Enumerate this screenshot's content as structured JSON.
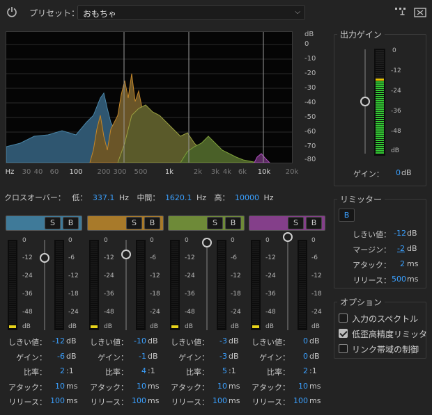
{
  "header": {
    "preset_label": "プリセット：",
    "preset_value": "おもちゃ"
  },
  "spectrum": {
    "db_scale": [
      "dB",
      "0",
      "-10",
      "-20",
      "-30",
      "-40",
      "-50",
      "-60",
      "-70",
      "-80"
    ],
    "hz_scale": [
      "Hz",
      "30",
      "40",
      "60",
      "100",
      "200",
      "300",
      "500",
      "1k",
      "2k",
      "3k",
      "4k",
      "6k",
      "10k",
      "20k"
    ]
  },
  "crossover": {
    "label": "クロスオーバー：",
    "low_label": "低：",
    "low_value": "337.1",
    "mid_label": "中間：",
    "mid_value": "1620.1",
    "high_label": "高：",
    "high_value": "10000",
    "unit": "Hz"
  },
  "bands": [
    {
      "color": "#3f7a99",
      "s": "S",
      "b": "B",
      "threshold": "-12",
      "gain": "-6",
      "ratio": "2",
      "attack": "10",
      "release": "100",
      "slider_db": -12
    },
    {
      "color": "#a87a2a",
      "s": "S",
      "b": "B",
      "threshold": "-10",
      "gain": "-1",
      "ratio": "4",
      "attack": "10",
      "release": "100",
      "slider_db": -10
    },
    {
      "color": "#6e8a38",
      "s": "S",
      "b": "B",
      "threshold": "-3",
      "gain": "-3",
      "ratio": "5",
      "attack": "10",
      "release": "100",
      "slider_db": -3
    },
    {
      "color": "#843f8a",
      "s": "S",
      "b": "B",
      "threshold": "0",
      "gain": "0",
      "ratio": "2",
      "attack": "10",
      "release": "100",
      "slider_db": 0
    }
  ],
  "band_labels": {
    "threshold": "しきい値：",
    "gain": "ゲイン：",
    "ratio": "比率：",
    "attack": "アタック：",
    "release": "リリース：",
    "db": "dB",
    "ratio_unit": ":1",
    "ms": "ms"
  },
  "band_scale_left": [
    "0",
    "-12",
    "-24",
    "-36",
    "-48",
    "dB"
  ],
  "band_scale_right": [
    "0",
    "-6",
    "-12",
    "-18",
    "-24",
    "dB"
  ],
  "output": {
    "title": "出力ゲイン",
    "scale": [
      "0",
      "-12",
      "-24",
      "-36",
      "-48",
      "dB"
    ],
    "gain_label": "ゲイン：",
    "gain_value": "0",
    "gain_unit": "dB"
  },
  "limiter": {
    "title": "リミッター",
    "b_label": "B",
    "threshold_label": "しきい値：",
    "threshold_value": "-12",
    "margin_label": "マージン：",
    "margin_value": "-2",
    "attack_label": "アタック：",
    "attack_value": "2",
    "release_label": "リリース：",
    "release_value": "500",
    "db": "dB",
    "ms": "ms"
  },
  "options": {
    "title": "オプション",
    "items": [
      {
        "label": "入力のスペクトル",
        "checked": false
      },
      {
        "label": "低歪高精度リミッタ",
        "checked": true
      },
      {
        "label": "リンク帯域の制御",
        "checked": false
      }
    ]
  },
  "colors": {
    "accent_blue": "#3aa0ff",
    "meter_green": "#33cc33",
    "meter_yellow": "#e6d21a",
    "limit_line": "#e6c200"
  }
}
